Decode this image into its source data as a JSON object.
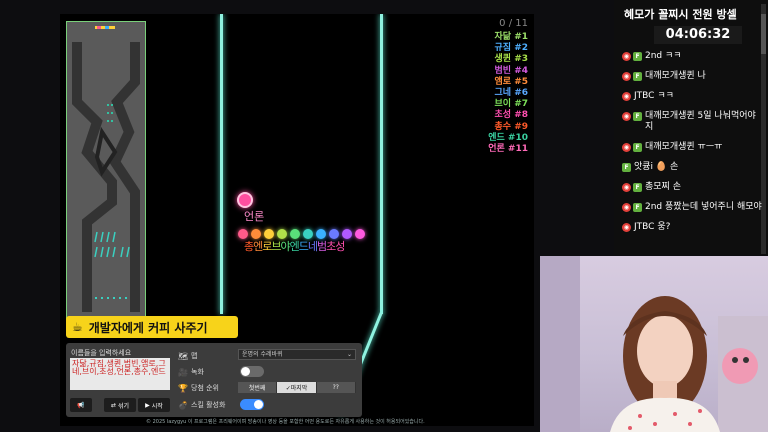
{
  "game": {
    "counter": "0 / 11",
    "ranking": [
      {
        "label": "자닮 #1",
        "color": "#9ce06a"
      },
      {
        "label": "규짐 #2",
        "color": "#4fb0ff"
      },
      {
        "label": "생퀸 #3",
        "color": "#a8e04a"
      },
      {
        "label": "범빈 #4",
        "color": "#d45ce0"
      },
      {
        "label": "앰로 #5",
        "color": "#ff8c3a"
      },
      {
        "label": "그네 #6",
        "color": "#5aa8ff"
      },
      {
        "label": "브이 #7",
        "color": "#7ce05a"
      },
      {
        "label": "초성 #8",
        "color": "#ff4fb0"
      },
      {
        "label": "총수 #9",
        "color": "#ff5a2a"
      },
      {
        "label": "엔드 #10",
        "color": "#3ad0a0"
      },
      {
        "label": "언론 #11",
        "color": "#ff6ab8"
      }
    ],
    "lead_marble_label": "언론",
    "marble_colors": [
      "#ff5a8a",
      "#ff8c3a",
      "#ffd03a",
      "#b0e04a",
      "#5ae07a",
      "#3ad0c0",
      "#3ab0ff",
      "#6a7aff",
      "#b05aff",
      "#ff5ae0"
    ],
    "marble_labels": [
      {
        "text": "총",
        "color": "#ff5a2a"
      },
      {
        "text": "엔",
        "color": "#ff8c3a"
      },
      {
        "text": "로",
        "color": "#ffd03a"
      },
      {
        "text": "브",
        "color": "#a8e04a"
      },
      {
        "text": "야",
        "color": "#5ae07a"
      },
      {
        "text": "엔",
        "color": "#3ad0a0"
      },
      {
        "text": "드",
        "color": "#3ab0ff"
      },
      {
        "text": "네",
        "color": "#6a7aff"
      },
      {
        "text": "범",
        "color": "#d45ce0"
      },
      {
        "text": "초성",
        "color": "#ff4fb0"
      }
    ]
  },
  "coffee_button": {
    "label": "개발자에게 커피 사주기",
    "icon": "coffee-cup-icon"
  },
  "settings": {
    "names_title": "이름들을 입력하세요",
    "names_text": "자닮,규짐,생퀸,범빈,앰로,그네,브이,초성,언론,총수,엔드",
    "shuffle_label": "섞기",
    "start_label": "시작",
    "map_label": "맵",
    "map_value": "운명의 수레바퀴",
    "record_label": "녹화",
    "record_on": false,
    "rank_label": "당첨 순위",
    "rank_options": [
      "첫번째",
      "마지막",
      "??"
    ],
    "rank_selected": "마지막",
    "skill_label": "스킬 활성화",
    "skill_on": true,
    "accent_color": "#3a8cff"
  },
  "copyright": "© 2025 lazygyu 이 프로그램은 프리웨어이며 방송이나 영상 등을 포함한 어떤 용도로든 자유롭게 사용하는 것이 허용되어있습니다.",
  "chat": {
    "title": "혜모가 꼴찌시 전원 방셀",
    "timer": "04:06:32",
    "messages": [
      {
        "badges": [
          "red",
          "green"
        ],
        "text": "2nd ㅋㅋ"
      },
      {
        "badges": [
          "red",
          "green"
        ],
        "text": "대깨모개생퀸 나"
      },
      {
        "badges": [
          "red"
        ],
        "text": "JTBC ㅋㅋ"
      },
      {
        "badges": [
          "red",
          "green"
        ],
        "text": "대깨모개생퀸 5일 나눠먹어야지"
      },
      {
        "badges": [
          "red",
          "green"
        ],
        "text": "대깨모개생퀸 ㅠㅡㅠ"
      },
      {
        "badges": [
          "green"
        ],
        "text": "앗큥i 🥚 손"
      },
      {
        "badges": [
          "red",
          "green"
        ],
        "text": "총모찌 손"
      },
      {
        "badges": [
          "red",
          "green"
        ],
        "text": "2nd 풍짰는데 넣어주니 해모야"
      },
      {
        "badges": [
          "red"
        ],
        "text": "JTBC 웅?"
      }
    ]
  }
}
